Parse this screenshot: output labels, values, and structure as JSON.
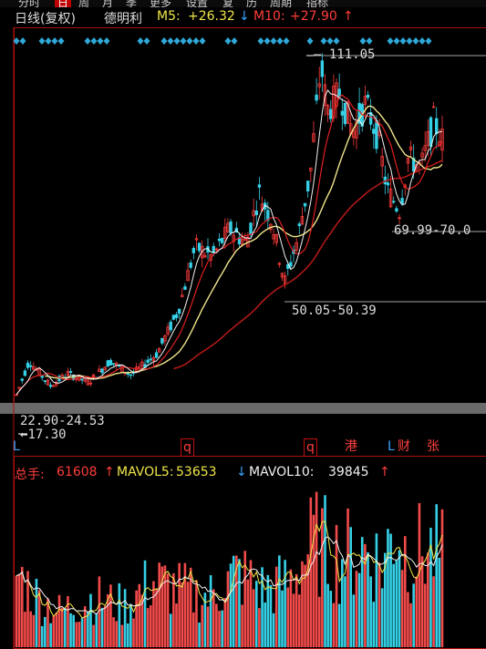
{
  "topbar": {
    "tabs": [
      "分时",
      "日",
      "周",
      "月",
      "季",
      "更多",
      "设置",
      "复",
      "历",
      "周期",
      "指标"
    ],
    "active_index": 1
  },
  "header": {
    "period": "日线(复权)",
    "stock_name": "德明利",
    "ma5_label": "M5:",
    "ma5_value": "+26.32",
    "ma5_arrow": "↓",
    "ma10_label": "M10:",
    "ma10_value": "+27.90",
    "ma10_arrow": "↑"
  },
  "annotations": {
    "high": "111.05",
    "range_right": "69.99-70.0",
    "range_mid": "50.05-50.39",
    "range_low": "22.90-24.53",
    "low": "17.30"
  },
  "markers": [
    {
      "text": "L",
      "color": "#3aa3ff"
    },
    {
      "text": "q",
      "color": "#ff4040"
    },
    {
      "text": "q",
      "color": "#ff4040"
    },
    {
      "text": "港",
      "color": "#ff4040"
    },
    {
      "text": "L",
      "color": "#3aa3ff"
    },
    {
      "text": "财",
      "color": "#ff4040"
    },
    {
      "text": "张",
      "color": "#ff4040"
    }
  ],
  "volume": {
    "label": "总手:",
    "value": "61608",
    "value_arrow": "↑",
    "mavol5_label": "MAVOL5:",
    "mavol5_value": "53653",
    "mavol5_arrow": "↓",
    "mavol10_label": "MAVOL10:",
    "mavol10_value": "39845",
    "mavol10_arrow": "↑"
  },
  "colors": {
    "up": "#ff3c3c",
    "down": "#35d0e6",
    "ma5": "#f2f2f2",
    "ma10": "#f0e64a",
    "ma20": "#ff3c3c",
    "ma60": "#c01818",
    "accent_red": "#ff3c3c",
    "yellow": "#f0e64a",
    "white": "#f2f2f2"
  },
  "chart_data": {
    "type": "candlestick",
    "title": "",
    "ylim": [
      17.3,
      111.05
    ],
    "price_points": [
      {
        "x": 0.0,
        "price": 18.5
      },
      {
        "x": 0.03,
        "price": 28.0
      },
      {
        "x": 0.08,
        "price": 21.0
      },
      {
        "x": 0.12,
        "price": 24.5
      },
      {
        "x": 0.17,
        "price": 22.0
      },
      {
        "x": 0.22,
        "price": 28.0
      },
      {
        "x": 0.27,
        "price": 24.0
      },
      {
        "x": 0.33,
        "price": 30.0
      },
      {
        "x": 0.38,
        "price": 42.0
      },
      {
        "x": 0.42,
        "price": 60.0
      },
      {
        "x": 0.46,
        "price": 57.0
      },
      {
        "x": 0.5,
        "price": 65.0
      },
      {
        "x": 0.54,
        "price": 61.0
      },
      {
        "x": 0.57,
        "price": 75.0
      },
      {
        "x": 0.6,
        "price": 67.0
      },
      {
        "x": 0.63,
        "price": 50.0
      },
      {
        "x": 0.66,
        "price": 62.0
      },
      {
        "x": 0.69,
        "price": 80.0
      },
      {
        "x": 0.715,
        "price": 111.0
      },
      {
        "x": 0.73,
        "price": 98.0
      },
      {
        "x": 0.76,
        "price": 103.0
      },
      {
        "x": 0.79,
        "price": 92.0
      },
      {
        "x": 0.82,
        "price": 100.0
      },
      {
        "x": 0.85,
        "price": 90.0
      },
      {
        "x": 0.87,
        "price": 76.0
      },
      {
        "x": 0.9,
        "price": 70.0
      },
      {
        "x": 0.92,
        "price": 85.0
      },
      {
        "x": 0.95,
        "price": 82.0
      },
      {
        "x": 0.98,
        "price": 95.0
      },
      {
        "x": 1.0,
        "price": 90.0
      }
    ],
    "volume_points": [
      {
        "x": 0.0,
        "v": 0.45
      },
      {
        "x": 0.05,
        "v": 0.3
      },
      {
        "x": 0.1,
        "v": 0.22
      },
      {
        "x": 0.18,
        "v": 0.3
      },
      {
        "x": 0.25,
        "v": 0.25
      },
      {
        "x": 0.32,
        "v": 0.4
      },
      {
        "x": 0.38,
        "v": 0.35
      },
      {
        "x": 0.45,
        "v": 0.3
      },
      {
        "x": 0.52,
        "v": 0.45
      },
      {
        "x": 0.58,
        "v": 0.35
      },
      {
        "x": 0.64,
        "v": 0.4
      },
      {
        "x": 0.7,
        "v": 0.65
      },
      {
        "x": 0.76,
        "v": 0.55
      },
      {
        "x": 0.82,
        "v": 0.6
      },
      {
        "x": 0.86,
        "v": 0.5
      },
      {
        "x": 0.89,
        "v": 0.75
      },
      {
        "x": 0.92,
        "v": 0.55
      },
      {
        "x": 0.96,
        "v": 0.6
      },
      {
        "x": 1.0,
        "v": 0.55
      }
    ]
  }
}
